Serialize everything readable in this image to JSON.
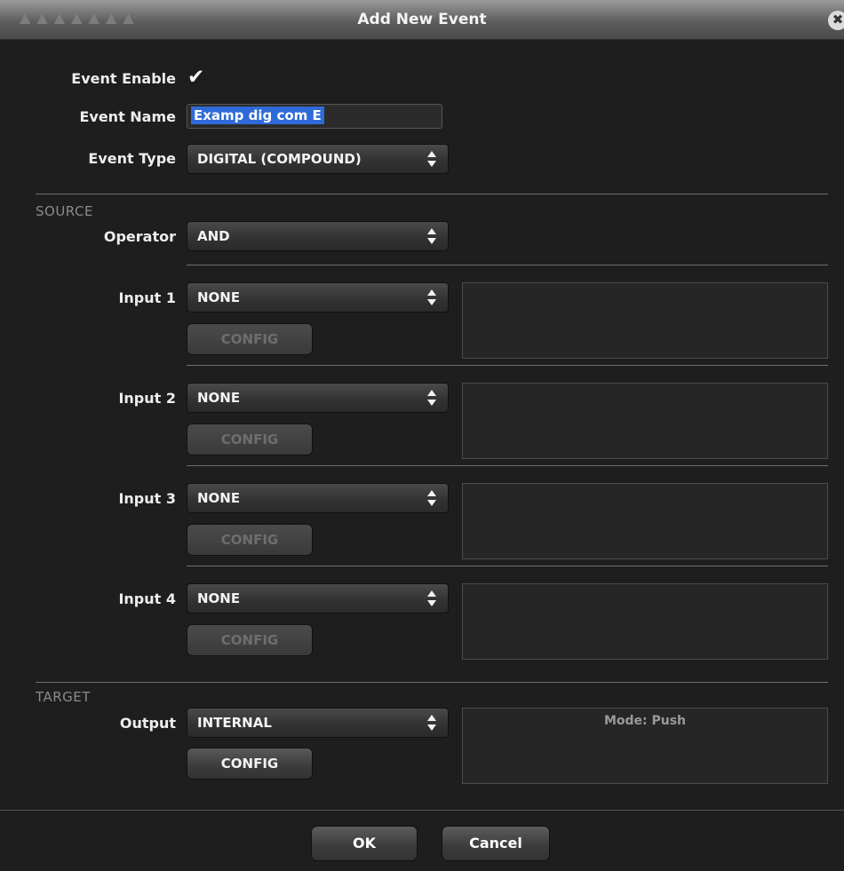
{
  "window": {
    "title": "Add New Event",
    "close_glyph": "✖",
    "ghost_text": "▲  ▲  ▲  ▲ ▲ ▲ ▲"
  },
  "event": {
    "enable_label": "Event Enable",
    "enable_checked": true,
    "name_label": "Event Name",
    "name_value": "Examp dig com E",
    "type_label": "Event Type",
    "type_value": "DIGITAL (COMPOUND)"
  },
  "source": {
    "section_title": "SOURCE",
    "operator_label": "Operator",
    "operator_value": "AND",
    "inputs": [
      {
        "label": "Input 1",
        "value": "NONE",
        "config_label": "CONFIG"
      },
      {
        "label": "Input 2",
        "value": "NONE",
        "config_label": "CONFIG"
      },
      {
        "label": "Input 3",
        "value": "NONE",
        "config_label": "CONFIG"
      },
      {
        "label": "Input 4",
        "value": "NONE",
        "config_label": "CONFIG"
      }
    ]
  },
  "target": {
    "section_title": "TARGET",
    "output_label": "Output",
    "output_value": "INTERNAL",
    "config_label": "CONFIG",
    "mode_text": "Mode: Push"
  },
  "footer": {
    "ok_label": "OK",
    "cancel_label": "Cancel"
  },
  "colors": {
    "background": "#1e1e1e",
    "selection": "#2f6bd8",
    "disabled_text": "#6e6e6e"
  }
}
